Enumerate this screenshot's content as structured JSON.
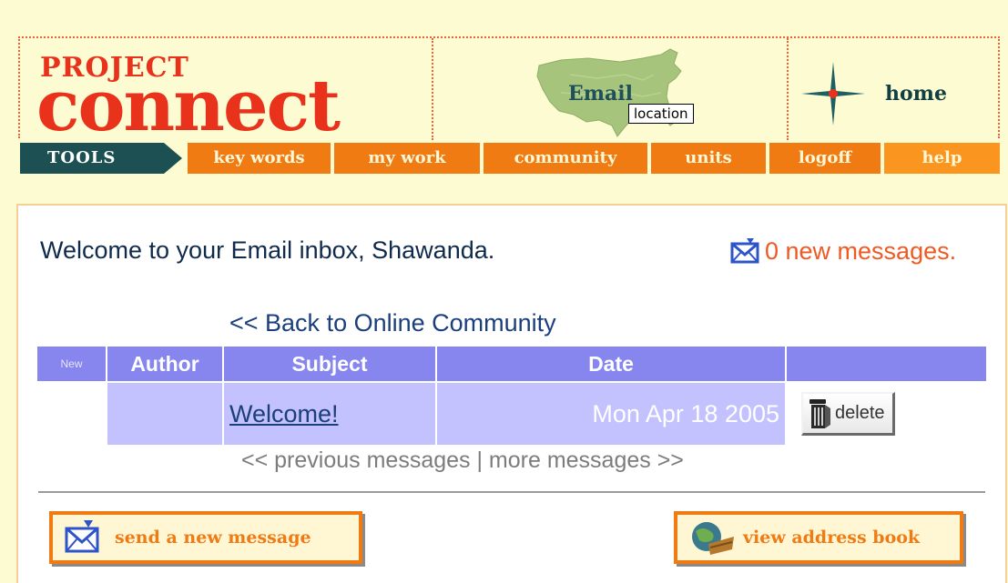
{
  "header": {
    "logo_top": "PROJECT",
    "logo_main": "connect",
    "map_label": "Email",
    "tooltip": "location",
    "home_label": "home"
  },
  "nav": {
    "tools_label": "TOOLS",
    "items": [
      {
        "label": "key words"
      },
      {
        "label": "my work"
      },
      {
        "label": "community"
      },
      {
        "label": "units"
      },
      {
        "label": "logoff"
      },
      {
        "label": "help"
      }
    ]
  },
  "main": {
    "welcome": "Welcome to your Email inbox, Shawanda.",
    "new_messages": "0 new messages.",
    "back_link": "<< Back to Online Community",
    "table": {
      "headers": [
        "New",
        "Author",
        "Subject",
        "Date",
        ""
      ],
      "rows": [
        {
          "new": "",
          "author": "",
          "subject": "Welcome!",
          "date": "Mon Apr 18 2005",
          "action": "delete"
        }
      ]
    },
    "pager": {
      "previous": "<< previous messages",
      "separator": " | ",
      "more": "more messages >>"
    },
    "send_button": "send a new message",
    "address_button": "view address book"
  },
  "colors": {
    "background": "#fdfbd2",
    "brand_red": "#e8321c",
    "nav_orange": "#f07b13",
    "nav_teal": "#1c5052",
    "table_header": "#8785ee",
    "table_row": "#c3c2ff",
    "new_messages": "#ef5a23"
  }
}
